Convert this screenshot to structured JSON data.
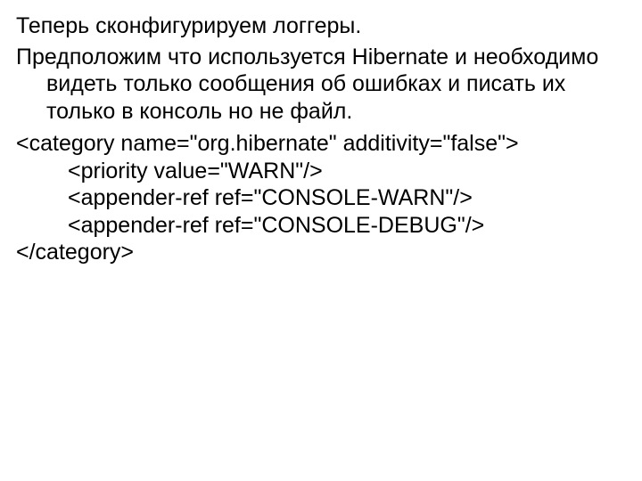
{
  "p1": "Теперь сконфигурируем логгеры.",
  "p2": "Предположим что используется Hibernate и необходимо видеть только сообщения об ошибках и писать их только в  консоль но не файл.",
  "code": {
    "l1": "<category  name=\"org.hibernate\" additivity=\"false\">",
    "l2": "<priority value=\"WARN\"/>",
    "l3": "<appender-ref ref=\"CONSOLE-WARN\"/>",
    "l4": "<appender-ref ref=\"CONSOLE-DEBUG\"/>",
    "l5": "</category>"
  }
}
